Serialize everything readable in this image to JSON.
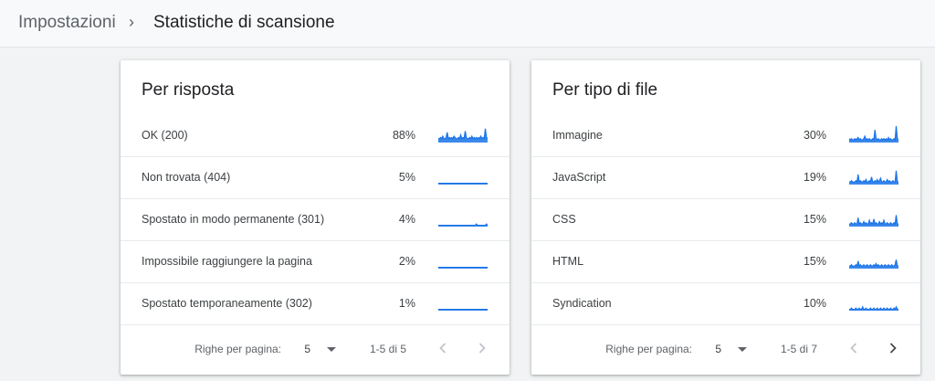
{
  "breadcrumb": {
    "parent": "Impostazioni",
    "separator": "›",
    "current": "Statistiche di scansione"
  },
  "cards": [
    {
      "title": "Per risposta",
      "rows": [
        {
          "label": "OK (200)",
          "pct": "88%",
          "spark": [
            3,
            3,
            4,
            3,
            5,
            3,
            3,
            4,
            8,
            3,
            4,
            3,
            4,
            3,
            5,
            4,
            3,
            3,
            4,
            3,
            6,
            3,
            4,
            3,
            9,
            4,
            3,
            3,
            4,
            3,
            5,
            3,
            4,
            3,
            4,
            3,
            4,
            3,
            5,
            3,
            4,
            3,
            11,
            4,
            3
          ]
        },
        {
          "label": "Non trovata (404)",
          "pct": "5%",
          "spark": [
            1,
            1,
            1,
            1,
            1,
            1,
            1,
            1,
            1,
            1,
            1,
            1,
            1,
            1,
            1,
            1,
            1,
            1,
            1,
            1,
            1,
            1,
            1,
            1,
            1,
            1,
            1,
            1,
            1,
            1,
            1,
            1,
            1,
            1,
            1,
            1,
            1,
            1,
            1,
            1,
            1,
            1,
            1,
            1,
            1
          ]
        },
        {
          "label": "Spostato in modo permanente (301)",
          "pct": "4%",
          "spark": [
            1,
            1,
            1,
            1,
            1,
            1,
            1,
            1,
            1,
            1,
            1,
            1,
            1,
            1,
            1,
            1,
            1,
            1,
            1,
            1,
            1,
            1,
            1,
            1,
            1,
            1,
            1,
            1,
            1,
            1,
            1,
            1,
            1,
            1,
            2,
            1,
            1,
            1,
            1,
            1,
            1,
            1,
            1,
            2,
            1
          ]
        },
        {
          "label": "Impossibile raggiungere la pagina",
          "pct": "2%",
          "spark": [
            1,
            1,
            1,
            1,
            1,
            1,
            1,
            1,
            1,
            1,
            1,
            1,
            1,
            1,
            1,
            1,
            1,
            1,
            1,
            1,
            1,
            1,
            1,
            1,
            1,
            1,
            1,
            1,
            1,
            1,
            1,
            1,
            1,
            1,
            1,
            1,
            1,
            1,
            1,
            1,
            1,
            1,
            1,
            1,
            1
          ]
        },
        {
          "label": "Spostato temporaneamente (302)",
          "pct": "1%",
          "spark": [
            1,
            1,
            1,
            1,
            1,
            1,
            1,
            1,
            1,
            1,
            1,
            1,
            1,
            1,
            1,
            1,
            1,
            1,
            1,
            1,
            1,
            1,
            1,
            1,
            1,
            1,
            1,
            1,
            1,
            1,
            1,
            1,
            1,
            1,
            1,
            1,
            1,
            1,
            1,
            1,
            1,
            1,
            1,
            1,
            1
          ]
        }
      ],
      "footer": {
        "rows_per_page_label": "Righe per pagina:",
        "rows_per_page": "5",
        "range": "1-5 di 5"
      }
    },
    {
      "title": "Per tipo di file",
      "rows": [
        {
          "label": "Immagine",
          "pct": "30%",
          "spark": [
            3,
            2,
            3,
            2,
            2,
            3,
            2,
            3,
            4,
            2,
            3,
            2,
            2,
            3,
            5,
            2,
            3,
            2,
            3,
            2,
            2,
            3,
            2,
            10,
            3,
            2,
            3,
            2,
            2,
            3,
            2,
            3,
            2,
            3,
            2,
            4,
            2,
            3,
            2,
            2,
            3,
            2,
            13,
            3,
            2
          ]
        },
        {
          "label": "JavaScript",
          "pct": "19%",
          "spark": [
            2,
            2,
            3,
            2,
            2,
            2,
            3,
            2,
            8,
            2,
            3,
            2,
            2,
            3,
            2,
            4,
            2,
            2,
            3,
            2,
            6,
            2,
            2,
            3,
            2,
            4,
            2,
            3,
            5,
            2,
            2,
            3,
            2,
            2,
            4,
            2,
            3,
            2,
            2,
            3,
            2,
            2,
            11,
            2,
            2
          ]
        },
        {
          "label": "CSS",
          "pct": "15%",
          "spark": [
            2,
            2,
            3,
            2,
            2,
            3,
            2,
            2,
            7,
            2,
            3,
            2,
            2,
            4,
            2,
            3,
            2,
            2,
            5,
            2,
            3,
            2,
            6,
            2,
            3,
            2,
            2,
            4,
            2,
            3,
            2,
            5,
            2,
            2,
            3,
            2,
            2,
            3,
            2,
            2,
            3,
            2,
            9,
            2,
            2
          ]
        },
        {
          "label": "HTML",
          "pct": "15%",
          "spark": [
            2,
            2,
            3,
            2,
            2,
            2,
            3,
            2,
            6,
            2,
            3,
            2,
            2,
            3,
            2,
            2,
            3,
            2,
            2,
            3,
            2,
            2,
            3,
            2,
            4,
            2,
            3,
            2,
            2,
            3,
            2,
            2,
            3,
            2,
            2,
            3,
            2,
            2,
            3,
            2,
            2,
            3,
            7,
            2,
            2
          ]
        },
        {
          "label": "Syndication",
          "pct": "10%",
          "spark": [
            1,
            1,
            2,
            1,
            1,
            1,
            2,
            1,
            1,
            2,
            1,
            1,
            3,
            1,
            1,
            2,
            1,
            1,
            1,
            2,
            1,
            1,
            2,
            1,
            1,
            2,
            1,
            1,
            2,
            1,
            1,
            2,
            1,
            1,
            2,
            1,
            1,
            2,
            1,
            1,
            2,
            1,
            3,
            1,
            1
          ]
        }
      ],
      "footer": {
        "rows_per_page_label": "Righe per pagina:",
        "rows_per_page": "5",
        "range": "1-5 di 7"
      }
    }
  ],
  "colors": {
    "sparkline": "#1a73e8",
    "nav_disabled": "#bdc1c6",
    "nav_enabled": "#3c4043"
  },
  "icons": {
    "dropdown": "triangle-down-icon",
    "prev": "chevron-left-icon",
    "next": "chevron-right-icon"
  }
}
